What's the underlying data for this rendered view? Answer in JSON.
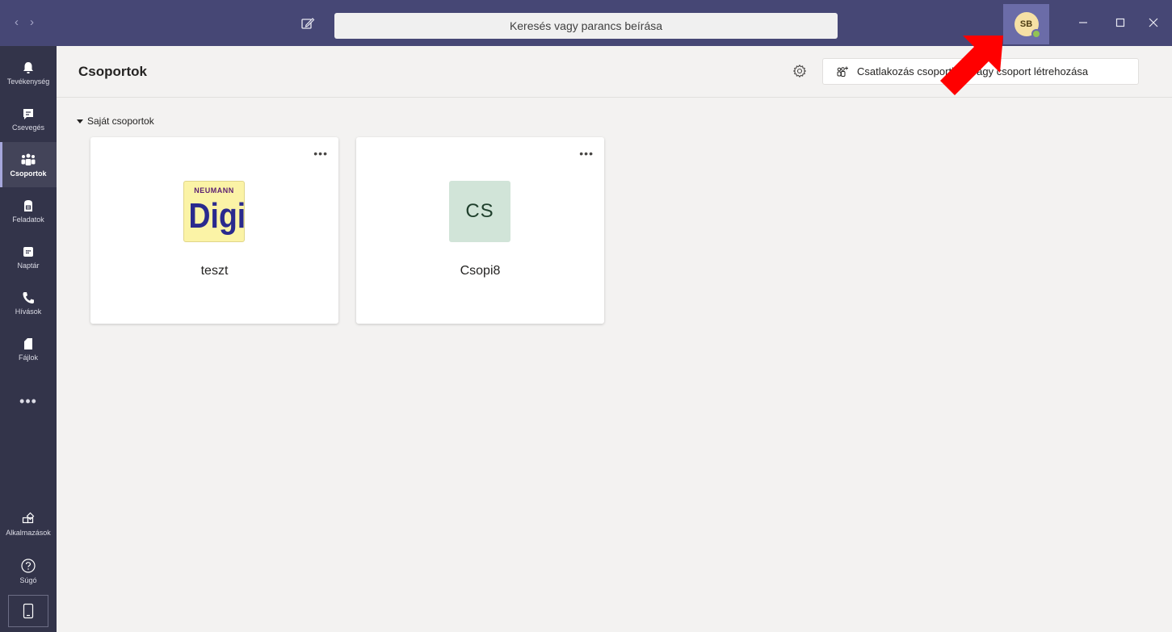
{
  "titlebar": {
    "back_glyph": "‹",
    "forward_glyph": "›",
    "compose_icon": "compose-icon",
    "search_placeholder": "Keresés vagy parancs beírása",
    "avatar_initials": "SB",
    "status_color": "#92c353"
  },
  "rail": {
    "items": [
      {
        "label": "Tevékenység",
        "icon": "bell-icon"
      },
      {
        "label": "Csevegés",
        "icon": "chat-icon"
      },
      {
        "label": "Csoportok",
        "icon": "teams-icon",
        "active": true
      },
      {
        "label": "Feladatok",
        "icon": "assignments-icon"
      },
      {
        "label": "Naptár",
        "icon": "calendar-icon"
      },
      {
        "label": "Hívások",
        "icon": "phone-icon"
      },
      {
        "label": "Fájlok",
        "icon": "files-icon"
      }
    ],
    "more_glyph": "•••",
    "bottom_items": [
      {
        "label": "Alkalmazások",
        "icon": "apps-icon"
      },
      {
        "label": "Súgó",
        "icon": "help-icon"
      }
    ]
  },
  "header": {
    "title": "Csoportok",
    "join_button_label": "Csatlakozás csoporthoz vagy csoport létrehozása"
  },
  "section": {
    "label": "Saját csoportok"
  },
  "teams": [
    {
      "name": "teszt",
      "logo_top": "NEUMANN",
      "logo_main": "Digi"
    },
    {
      "name": "Csopi8",
      "initials": "CS"
    }
  ],
  "colors": {
    "titlebar": "#464775",
    "rail": "#33344a",
    "accent": "#6264a7",
    "annotation_arrow": "#ff0000"
  }
}
